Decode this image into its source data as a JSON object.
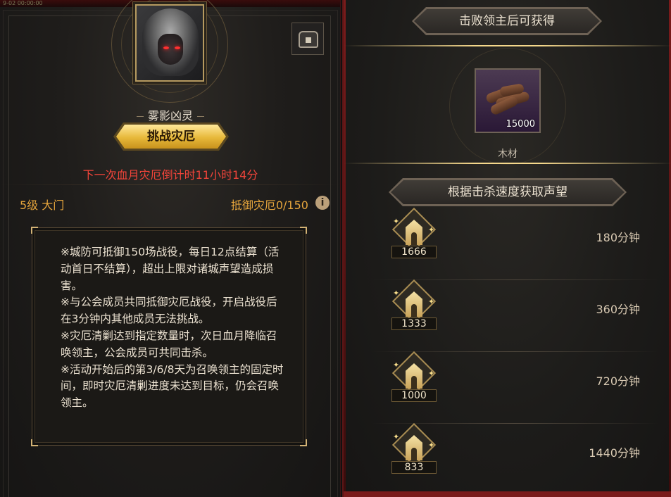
{
  "left_panel": {
    "top_text": "9-02 00:00:00",
    "boss_name": "雾影凶灵",
    "challenge_button": "挑战灾厄",
    "countdown": "下一次血月灾厄倒计时11小时14分",
    "level_label": "5级  大门",
    "defense_label": "抵御灾厄0/150",
    "info_icon": "i",
    "description": "※城防可抵御150场战役，每日12点结算（活动首日不结算），超出上限对诸城声望造成损害。\n※与公会成员共同抵御灾厄战役，开启战役后在3分钟内其他成员无法挑战。\n※灾厄清剿达到指定数量时，次日血月降临召唤领主，公会成员可共同击杀。\n※活动开始后的第3/6/8天为召唤领主的固定时间，即时灾厄清剿进度未达到目标，仍会召唤领主。"
  },
  "right_panel": {
    "reward_banner": "击败领主后可获得",
    "reward": {
      "name": "木材",
      "count": "15000",
      "icon": "wood-icon"
    },
    "reputation_banner": "根据击杀速度获取声望",
    "kill_rows": [
      {
        "reputation": "1666",
        "time": "180分钟"
      },
      {
        "reputation": "1333",
        "time": "360分钟"
      },
      {
        "reputation": "1000",
        "time": "720分钟"
      },
      {
        "reputation": "833",
        "time": "1440分钟"
      }
    ]
  },
  "colors": {
    "accent_gold": "#e7b83a",
    "countdown_red": "#f1443a",
    "label_orange": "#e6a53c",
    "panel_dark": "#1d1c1a",
    "border_red": "#7a1b1b"
  }
}
